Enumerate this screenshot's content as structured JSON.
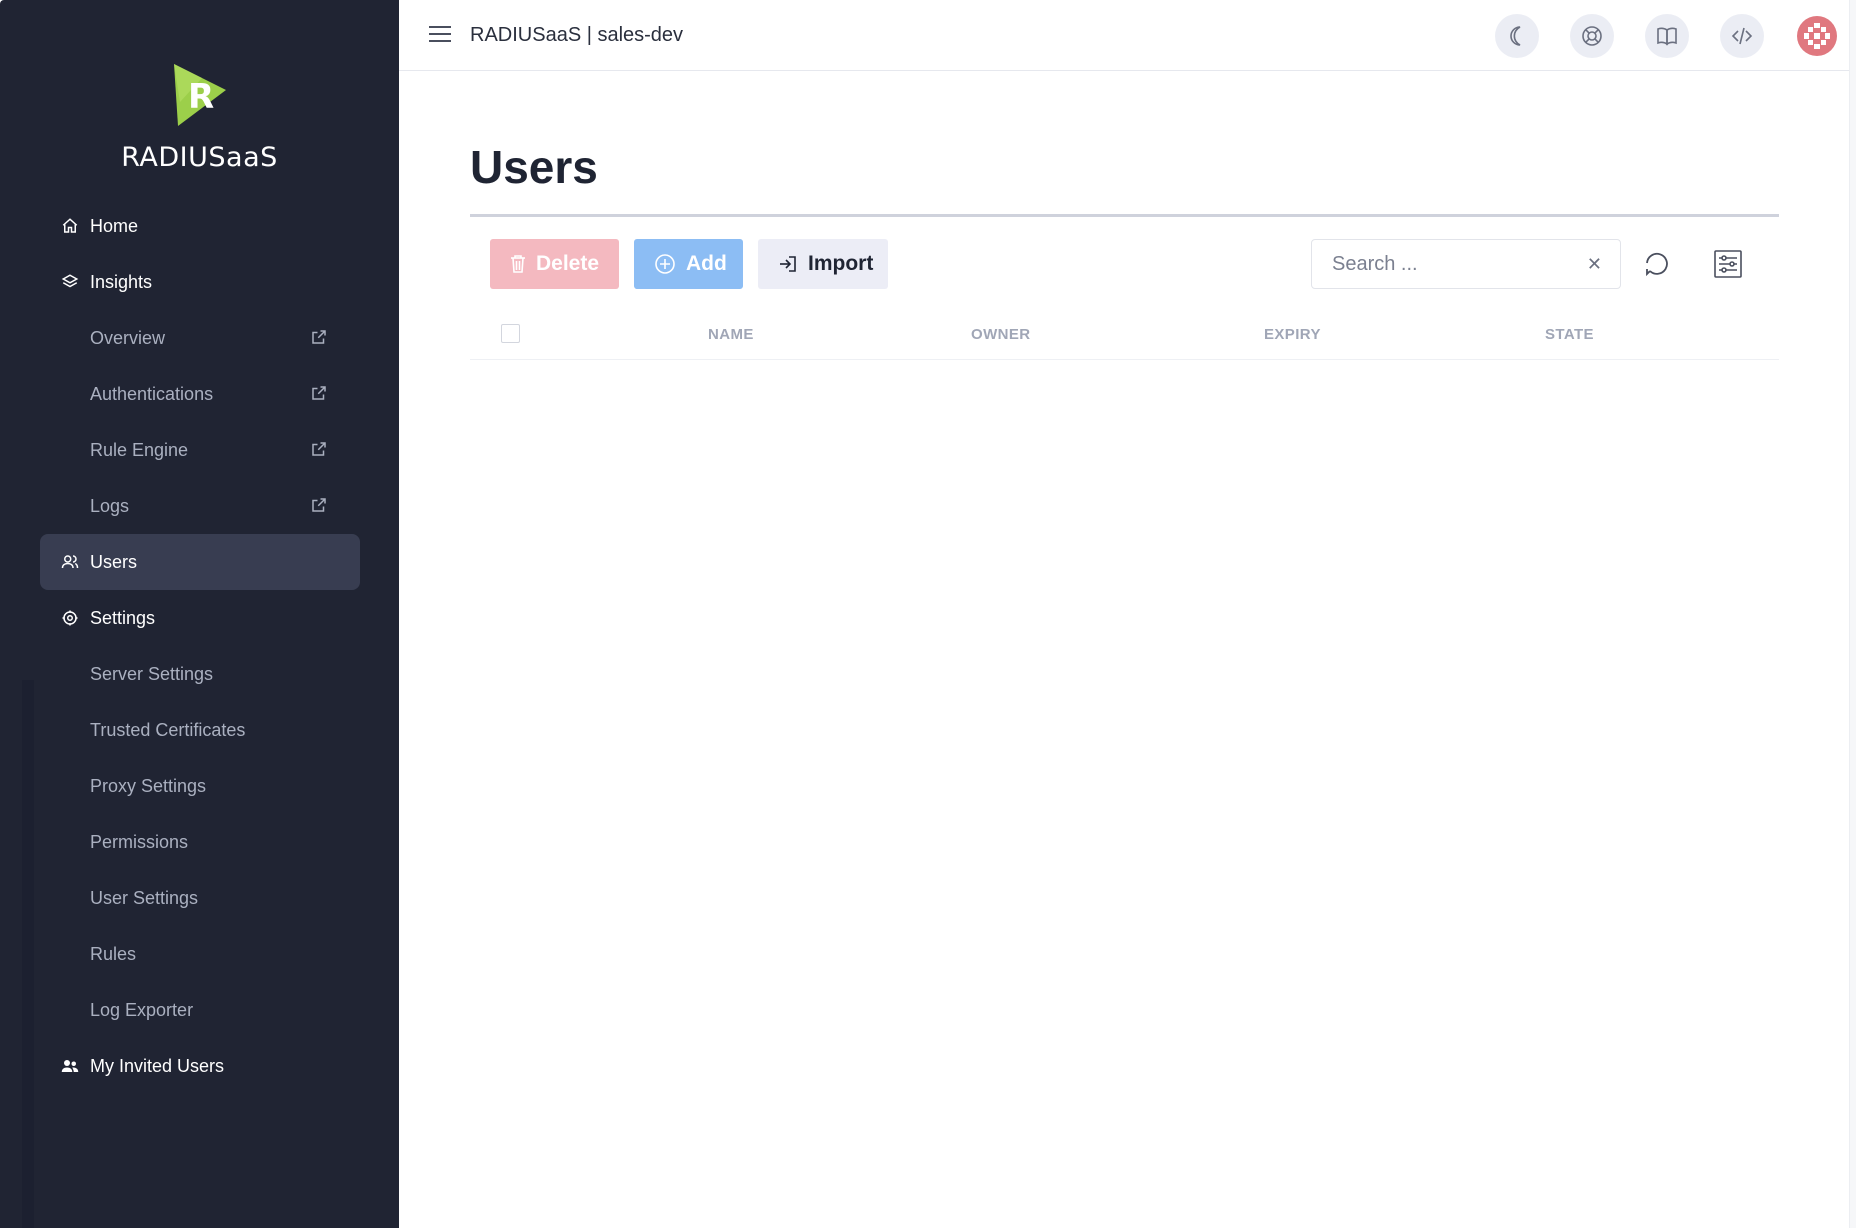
{
  "app": {
    "brand": "RADIUSaaS",
    "title": "RADIUSaaS | sales-dev"
  },
  "sidebar": {
    "items": [
      {
        "label": "Home",
        "icon": "home-icon",
        "type": "top"
      },
      {
        "label": "Insights",
        "icon": "layers-icon",
        "type": "top"
      },
      {
        "label": "Overview",
        "icon": "external-link-icon",
        "type": "sub"
      },
      {
        "label": "Authentications",
        "icon": "external-link-icon",
        "type": "sub"
      },
      {
        "label": "Rule Engine",
        "icon": "external-link-icon",
        "type": "sub"
      },
      {
        "label": "Logs",
        "icon": "external-link-icon",
        "type": "sub"
      },
      {
        "label": "Users",
        "icon": "users-icon",
        "type": "top",
        "active": true
      },
      {
        "label": "Settings",
        "icon": "gear-icon",
        "type": "top"
      },
      {
        "label": "Server Settings",
        "type": "sub"
      },
      {
        "label": "Trusted Certificates",
        "type": "sub"
      },
      {
        "label": "Proxy Settings",
        "type": "sub"
      },
      {
        "label": "Permissions",
        "type": "sub"
      },
      {
        "label": "User Settings",
        "type": "sub"
      },
      {
        "label": "Rules",
        "type": "sub"
      },
      {
        "label": "Log Exporter",
        "type": "sub"
      },
      {
        "label": "My Invited Users",
        "icon": "people-icon",
        "type": "top"
      }
    ]
  },
  "topbar": {
    "icons": [
      "moon-icon",
      "lifebuoy-icon",
      "book-icon",
      "code-icon",
      "avatar"
    ]
  },
  "main": {
    "title": "Users",
    "toolbar": {
      "delete_label": "Delete",
      "add_label": "Add",
      "import_label": "Import"
    },
    "search": {
      "placeholder": "Search ...",
      "value": ""
    },
    "table": {
      "columns": [
        "NAME",
        "OWNER",
        "EXPIRY",
        "STATE"
      ],
      "rows": []
    }
  },
  "colors": {
    "sidebar_bg": "#202433",
    "sidebar_active": "#383d51",
    "delete_btn": "#f4b9c0",
    "add_btn": "#8cbdf4",
    "import_btn": "#ecedf6",
    "logo_green": "#9ccf4a",
    "avatar_red": "#e0787f"
  }
}
